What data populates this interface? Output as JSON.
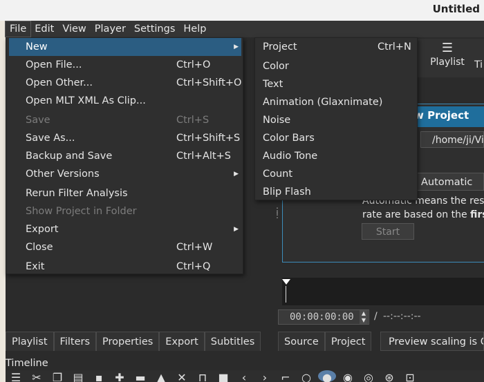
{
  "window": {
    "title": "Untitled"
  },
  "menubar": [
    "File",
    "Edit",
    "View",
    "Player",
    "Settings",
    "Help"
  ],
  "file_menu": [
    {
      "label": "New",
      "shortcut": "",
      "submenu": true,
      "disabled": false,
      "highlighted": true
    },
    {
      "label": "Open File...",
      "shortcut": "Ctrl+O",
      "submenu": false,
      "disabled": false
    },
    {
      "label": "Open Other...",
      "shortcut": "Ctrl+Shift+O",
      "submenu": false,
      "disabled": false
    },
    {
      "label": "Open MLT XML As Clip...",
      "shortcut": "",
      "submenu": false,
      "disabled": false
    },
    {
      "label": "Save",
      "shortcut": "Ctrl+S",
      "submenu": false,
      "disabled": true
    },
    {
      "label": "Save As...",
      "shortcut": "Ctrl+Shift+S",
      "submenu": false,
      "disabled": false
    },
    {
      "label": "Backup and Save",
      "shortcut": "Ctrl+Alt+S",
      "submenu": false,
      "disabled": false
    },
    {
      "label": "Other Versions",
      "shortcut": "",
      "submenu": true,
      "disabled": false
    },
    {
      "label": "Rerun Filter Analysis",
      "shortcut": "",
      "submenu": false,
      "disabled": false
    },
    {
      "label": "Show Project in Folder",
      "shortcut": "",
      "submenu": false,
      "disabled": true
    },
    {
      "label": "Export",
      "shortcut": "",
      "submenu": true,
      "disabled": false
    },
    {
      "label": "Close",
      "shortcut": "Ctrl+W",
      "submenu": false,
      "disabled": false
    },
    {
      "label": "Exit",
      "shortcut": "Ctrl+Q",
      "submenu": false,
      "disabled": false
    }
  ],
  "new_submenu": [
    {
      "label": "Project",
      "shortcut": "Ctrl+N"
    },
    {
      "label": "Color",
      "shortcut": ""
    },
    {
      "label": "Text",
      "shortcut": ""
    },
    {
      "label": "Animation (Glaxnimate)",
      "shortcut": ""
    },
    {
      "label": "Noise",
      "shortcut": ""
    },
    {
      "label": "Color Bars",
      "shortcut": ""
    },
    {
      "label": "Audio Tone",
      "shortcut": ""
    },
    {
      "label": "Count",
      "shortcut": ""
    },
    {
      "label": "Blip Flash",
      "shortcut": ""
    }
  ],
  "right_toolbar": {
    "playlist_label": "Playlist",
    "timeline_cut": "Ti"
  },
  "new_project": {
    "title": "w Project",
    "path": "/home/ji/Vi",
    "mode": "Automatic",
    "desc_line1": "Automatic means the reso",
    "desc_line2_prefix": "rate are based on the ",
    "desc_line2_bold": "first",
    "start_label": "Start"
  },
  "player": {
    "timecode": "00:00:00:00",
    "separator": "/",
    "duration": "--:--:--:--"
  },
  "bottom_tabs_left": [
    "Playlist",
    "Filters",
    "Properties",
    "Export",
    "Subtitles"
  ],
  "bottom_tabs_right": [
    "Source",
    "Project"
  ],
  "preview_scaling": "Preview scaling is O",
  "timeline_label": "Timeline",
  "colors": {
    "highlight": "#2b5d82",
    "panel_accent": "#1f6e9c"
  }
}
